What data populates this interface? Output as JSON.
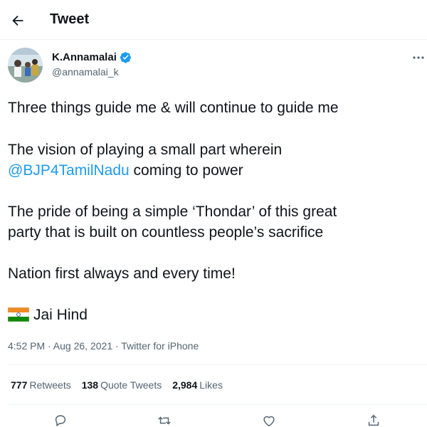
{
  "header": {
    "title": "Tweet"
  },
  "author": {
    "name": "K.Annamalai",
    "handle": "@annamalai_k",
    "verified": true
  },
  "tweet": {
    "line1": "Three things guide me & will continue to guide me",
    "line2": "The vision of playing a small part wherein",
    "mention": "@BJP4TamilNadu",
    "line3_rest": " coming to power",
    "line4": "The pride of being a simple ‘Thondar’ of this great",
    "line5": "party that is built on countless people’s sacrifice",
    "line6": "Nation first always and every time!",
    "line7": "Jai Hind"
  },
  "meta": {
    "text": "4:52 PM · Aug 26, 2021 · Twitter for iPhone"
  },
  "stats": {
    "retweets_count": "777",
    "retweets_label": "Retweets",
    "quotes_count": "138",
    "quotes_label": "Quote Tweets",
    "likes_count": "2,984",
    "likes_label": "Likes"
  },
  "icons": {
    "back": "arrow-left-icon",
    "verified": "verified-badge-icon",
    "more": "more-horizontal-icon",
    "flag": "india-flag-emoji",
    "reply": "reply-icon",
    "retweet": "retweet-icon",
    "like": "heart-icon",
    "share": "share-icon"
  },
  "colors": {
    "accent": "#1d9bf0",
    "text": "#0f1419",
    "secondary": "#536471",
    "border": "#eff3f4"
  }
}
